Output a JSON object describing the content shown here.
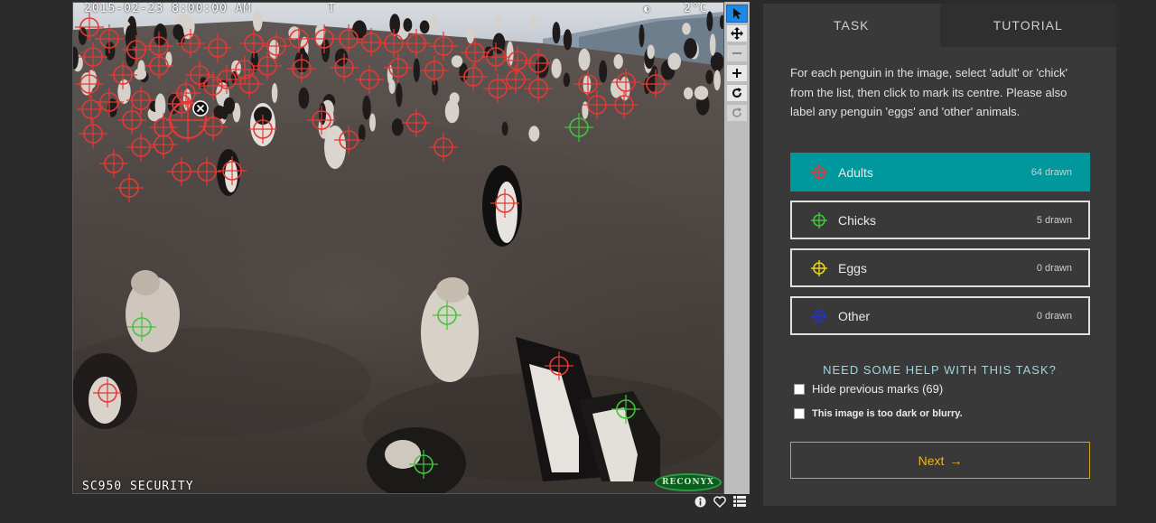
{
  "viewer": {
    "datetime": "2015-02-23 8:00:00 AM",
    "flag": "T",
    "moon": "◐",
    "temperature": "2°C",
    "camera_label": "SC950 SECURITY",
    "brand": "RECONYX",
    "photo_alt": "Camera-trap photo of a penguin colony on a muddy slope with placed markers"
  },
  "toolbar": {
    "tools": [
      "pointer",
      "pan",
      "zoom-out",
      "zoom-in",
      "rotate",
      "reset"
    ]
  },
  "meta_icons": [
    "info",
    "favorite",
    "collections"
  ],
  "panel": {
    "tabs": [
      "TASK",
      "TUTORIAL"
    ],
    "instructions": "For each penguin in the image, select 'adult' or 'chick' from the list, then click to mark its centre. Please also label any penguin 'eggs' and 'other' animals.",
    "choices": [
      {
        "label": "Adults",
        "count": "64 drawn",
        "color": "#e53935",
        "selected": true
      },
      {
        "label": "Chicks",
        "count": "5 drawn",
        "color": "#43c43a",
        "selected": false
      },
      {
        "label": "Eggs",
        "count": "0 drawn",
        "color": "#e6d21d",
        "selected": false
      },
      {
        "label": "Other",
        "count": "0 drawn",
        "color": "#2233cc",
        "selected": false
      }
    ],
    "help_heading": "NEED SOME HELP WITH THIS TASK?",
    "hide_marks_label": "Hide previous marks (69)",
    "dark_blurry_label": "This image is too dark or blurry.",
    "next_label": "Next",
    "next_arrow": "→"
  },
  "colors": {
    "background": "#2b2b2b",
    "panel": "#393939",
    "selected": "#00979d",
    "adult_marker": "#e53935",
    "chick_marker": "#43c43a",
    "next_border": "#d4a417"
  }
}
